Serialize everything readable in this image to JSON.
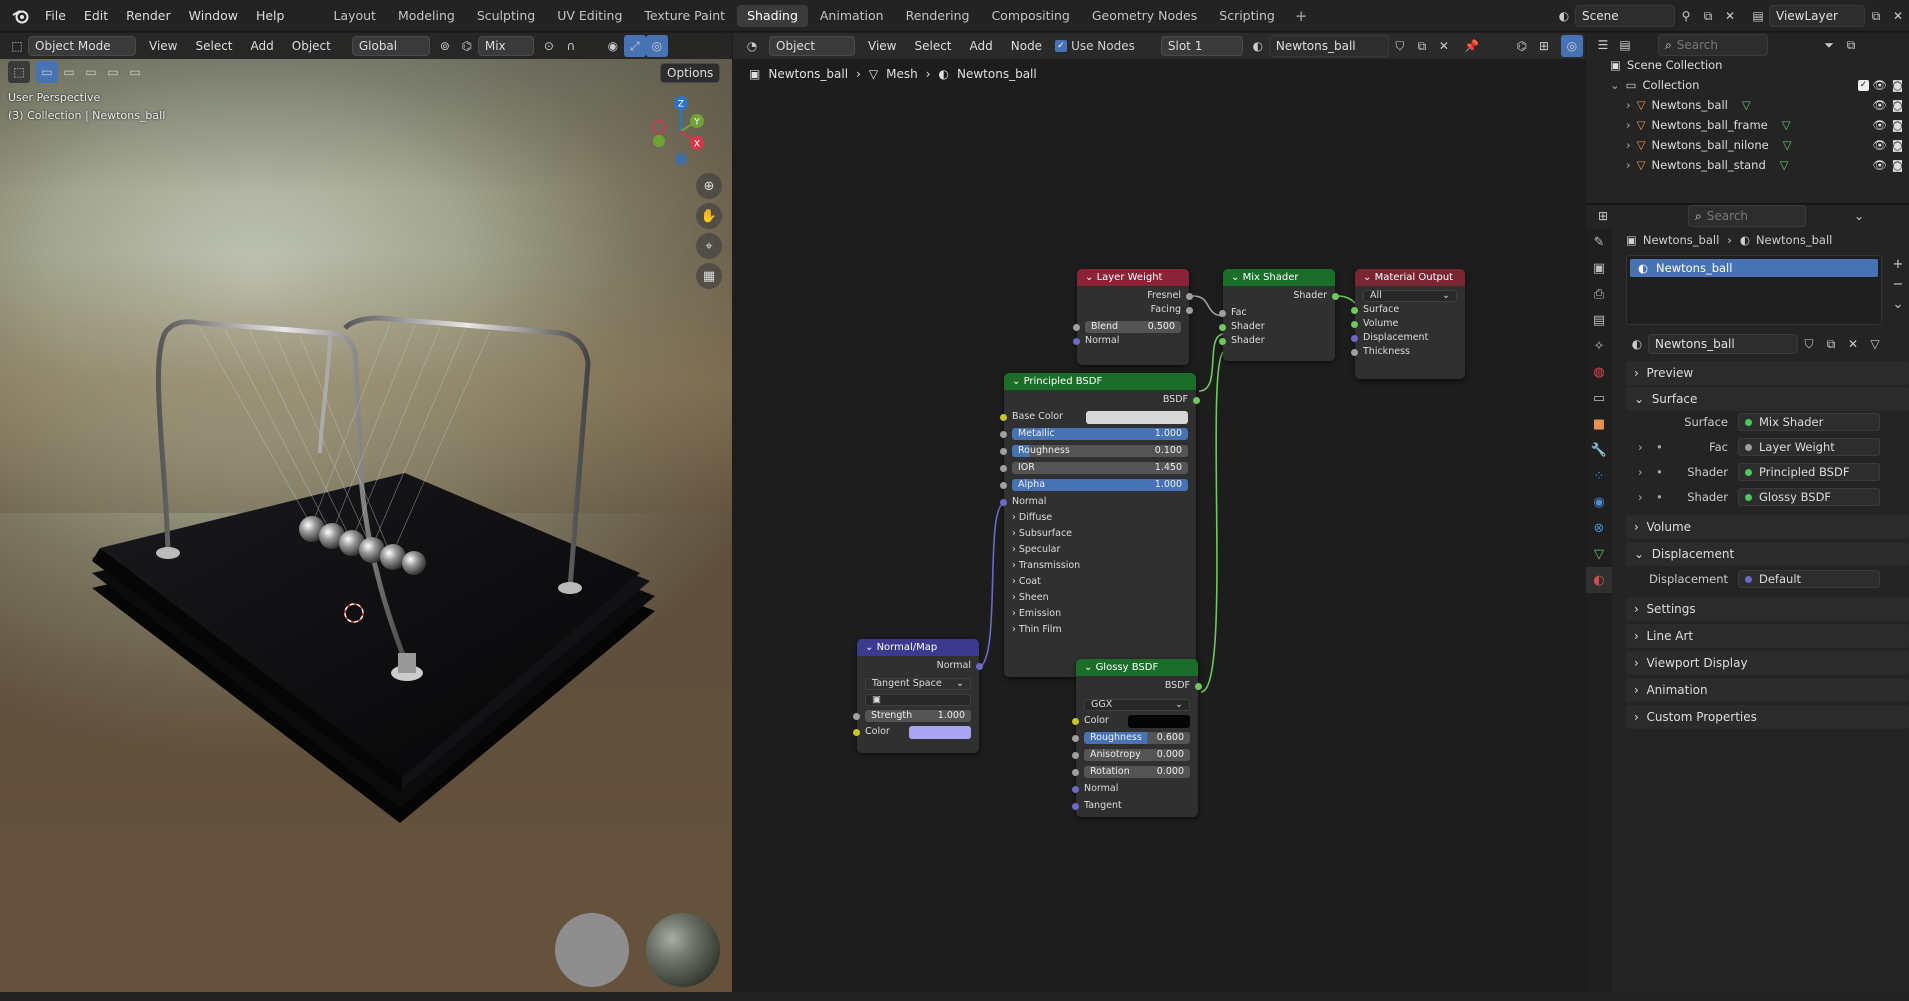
{
  "menu": [
    "File",
    "Edit",
    "Render",
    "Window",
    "Help"
  ],
  "workspaces": {
    "tabs": [
      "Layout",
      "Modeling",
      "Sculpting",
      "UV Editing",
      "Texture Paint",
      "Shading",
      "Animation",
      "Rendering",
      "Compositing",
      "Geometry Nodes",
      "Scripting"
    ],
    "active": "Shading",
    "plus": "+"
  },
  "top_right": {
    "scene": "Scene",
    "view_layer": "ViewLayer"
  },
  "viewport": {
    "mode": "Object Mode",
    "menus": [
      "View",
      "Select",
      "Add",
      "Object"
    ],
    "orientation": "Global",
    "shading": "Mix",
    "options": "Options",
    "info_line1": "User Perspective",
    "info_line2": "(3) Collection | Newtons_ball",
    "gizmo": {
      "z": "Z",
      "y": "Y",
      "x": "X"
    }
  },
  "node_editor": {
    "object_mode": "Object",
    "menus": [
      "View",
      "Select",
      "Add",
      "Node"
    ],
    "use_nodes": "Use Nodes",
    "slot": "Slot 1",
    "material": "Newtons_ball",
    "breadcrumb": [
      "Newtons_ball",
      "Mesh",
      "Newtons_ball"
    ],
    "nodes": {
      "layer_weight": {
        "title": "Layer Weight",
        "fresnel": "Fresnel",
        "facing": "Facing",
        "blend_label": "Blend",
        "blend": "0.500",
        "normal": "Normal"
      },
      "mix_shader": {
        "title": "Mix Shader",
        "out": "Shader",
        "fac": "Fac",
        "s1": "Shader",
        "s2": "Shader"
      },
      "material_output": {
        "title": "Material Output",
        "target": "All",
        "surface": "Surface",
        "volume": "Volume",
        "displacement": "Displacement",
        "thickness": "Thickness"
      },
      "principled": {
        "title": "Principled BSDF",
        "out": "BSDF",
        "base_color": "Base Color",
        "metallic_label": "Metallic",
        "metallic": "1.000",
        "roughness_label": "Roughness",
        "roughness": "0.100",
        "ior_label": "IOR",
        "ior": "1.450",
        "alpha_label": "Alpha",
        "alpha": "1.000",
        "normal": "Normal",
        "panels": [
          "Diffuse",
          "Subsurface",
          "Specular",
          "Transmission",
          "Coat",
          "Sheen",
          "Emission",
          "Thin Film"
        ]
      },
      "normal_map": {
        "title": "Normal/Map",
        "out": "Normal",
        "space": "Tangent Space",
        "strength_label": "Strength",
        "strength": "1.000",
        "color": "Color"
      },
      "glossy": {
        "title": "Glossy BSDF",
        "out": "BSDF",
        "distribution": "GGX",
        "color": "Color",
        "roughness_label": "Roughness",
        "roughness": "0.600",
        "aniso_label": "Anisotropy",
        "aniso": "0.000",
        "rotation_label": "Rotation",
        "rotation": "0.000",
        "normal": "Normal",
        "tangent": "Tangent"
      }
    }
  },
  "outliner": {
    "search_placeholder": "Search",
    "scene_collection": "Scene Collection",
    "collection": "Collection",
    "items": [
      "Newtons_ball",
      "Newtons_ball_frame",
      "Newtons_ball_nilone",
      "Newtons_ball_stand"
    ]
  },
  "properties": {
    "search_placeholder": "Search",
    "breadcrumb": [
      "Newtons_ball",
      "Newtons_ball"
    ],
    "slot_item": "Newtons_ball",
    "material_name": "Newtons_ball",
    "sections": {
      "preview": "Preview",
      "surface": "Surface",
      "volume": "Volume",
      "displacement": "Displacement",
      "settings": "Settings",
      "line_art": "Line Art",
      "viewport_display": "Viewport Display",
      "animation": "Animation",
      "custom_properties": "Custom Properties"
    },
    "surface_rows": [
      {
        "label": "Surface",
        "value": "Mix Shader"
      },
      {
        "label": "Fac",
        "value": "Layer Weight"
      },
      {
        "label": "Shader",
        "value": "Principled BSDF"
      },
      {
        "label": "Shader",
        "value": "Glossy BSDF"
      }
    ],
    "displacement_row": {
      "label": "Displacement",
      "value": "Default"
    }
  },
  "colors": {
    "accent": "#4772b3",
    "node_shader": "#1b6e2a",
    "node_input": "#8a2336",
    "node_vector": "#3b3a8e",
    "node_output": "#7a2630",
    "link": "#6ec85f"
  }
}
